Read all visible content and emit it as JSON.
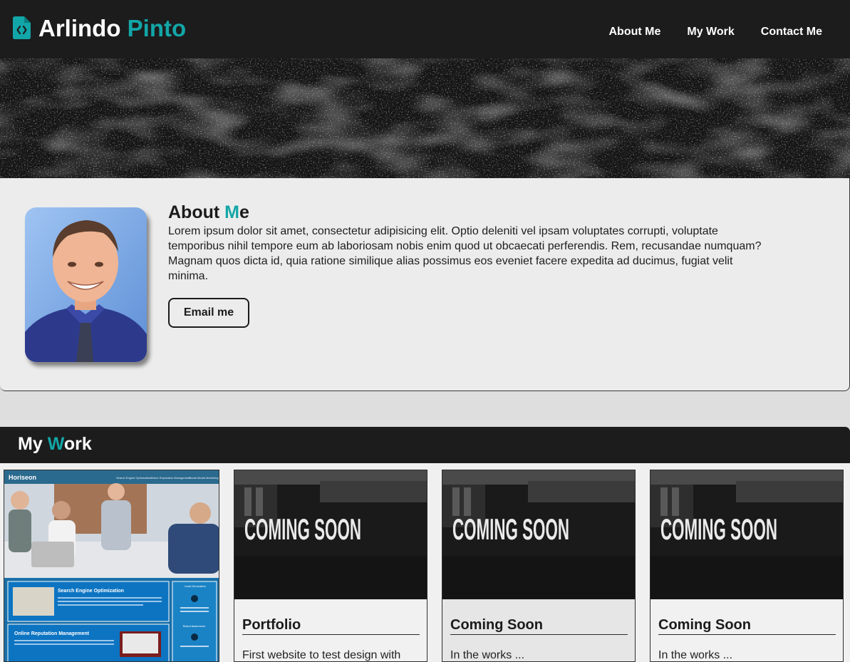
{
  "header": {
    "brand_first": "Arlindo",
    "brand_last": "Pinto",
    "nav": [
      "About Me",
      "My Work",
      "Contact Me"
    ]
  },
  "about": {
    "title_before": "About ",
    "title_accent": "M",
    "title_after": "e",
    "text": "Lorem ipsum dolor sit amet, consectetur adipisicing elit. Optio deleniti vel ipsam voluptates corrupti, voluptate temporibus nihil tempore eum ab laboriosam nobis enim quod ut obcaecati perferendis. Rem, recusandae numquam? Magnam quos dicta id, quia ratione similique alias possimus eos eveniet facere expedita ad ducimus, fugiat velit minima.",
    "button_label": "Email me"
  },
  "work": {
    "title_before": "My ",
    "title_accent": "W",
    "title_after": "ork",
    "screenshot": {
      "site_name": "Horiseon",
      "nav": [
        "Search Engine Optimization",
        "Online Reputation Management",
        "Social Media Marketing"
      ],
      "section_1": "Search Engine Optimization",
      "section_2": "Online Reputation Management",
      "side_1": "Lead Generation",
      "side_2": "Brand Awareness"
    },
    "coming_soon_text": "COMING SOON",
    "cards": [
      {
        "title": "Portfolio",
        "desc": "First website to test design with"
      },
      {
        "title": "Coming Soon",
        "desc": "In the works ..."
      },
      {
        "title": "Coming Soon",
        "desc": "In the works ..."
      }
    ]
  },
  "colors": {
    "accent": "#13a6a8",
    "header_bg": "#1c1c1c",
    "section_bg": "#ececec"
  },
  "icons": {
    "logo": "file-code-icon"
  }
}
